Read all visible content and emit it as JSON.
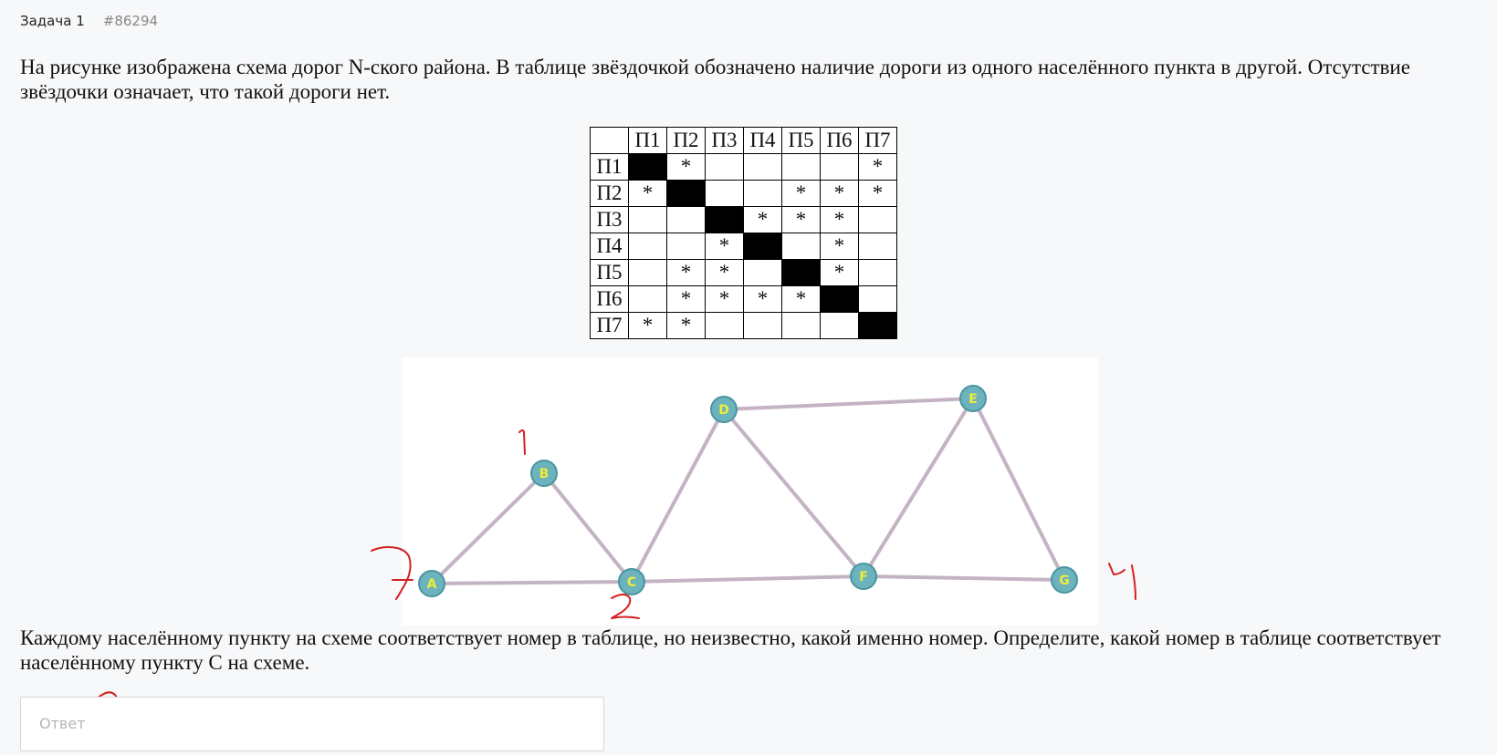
{
  "header": {
    "title": "Задача 1",
    "id": "#86294"
  },
  "question": "На рисунке изображена схема дорог N-ского района. В таблице звёздочкой обозначено наличие дороги из одного населённого пункта в другой. Отсутствие звёздочки означает, что такой дороги нет.",
  "table": {
    "headers": [
      "П1",
      "П2",
      "П3",
      "П4",
      "П5",
      "П6",
      "П7"
    ],
    "rows": [
      {
        "label": "П1",
        "cells": [
          "#",
          "*",
          "",
          "",
          "",
          "",
          "*"
        ]
      },
      {
        "label": "П2",
        "cells": [
          "*",
          "#",
          "",
          "",
          "*",
          "*",
          "*"
        ]
      },
      {
        "label": "П3",
        "cells": [
          "",
          "",
          "#",
          "*",
          "*",
          "*",
          ""
        ]
      },
      {
        "label": "П4",
        "cells": [
          "",
          "",
          "*",
          "#",
          "",
          "*",
          ""
        ]
      },
      {
        "label": "П5",
        "cells": [
          "",
          "*",
          "*",
          "",
          "#",
          "*",
          ""
        ]
      },
      {
        "label": "П6",
        "cells": [
          "",
          "*",
          "*",
          "*",
          "*",
          "#",
          ""
        ]
      },
      {
        "label": "П7",
        "cells": [
          "*",
          "*",
          "",
          "",
          "",
          "",
          "#"
        ]
      }
    ]
  },
  "graph": {
    "edge_color": "#c3b3c3",
    "node_fill": "#6cb3bd",
    "node_stroke": "#4a95a0",
    "label_color": "#f0ec3a",
    "nodes": [
      {
        "id": "A"
      },
      {
        "id": "B"
      },
      {
        "id": "C"
      },
      {
        "id": "D"
      },
      {
        "id": "E"
      },
      {
        "id": "F"
      },
      {
        "id": "G"
      }
    ],
    "edges": [
      [
        "A",
        "B"
      ],
      [
        "A",
        "C"
      ],
      [
        "B",
        "C"
      ],
      [
        "C",
        "D"
      ],
      [
        "C",
        "F"
      ],
      [
        "D",
        "E"
      ],
      [
        "D",
        "F"
      ],
      [
        "E",
        "F"
      ],
      [
        "E",
        "G"
      ],
      [
        "F",
        "G"
      ]
    ]
  },
  "annotations": {
    "color": "#d42020",
    "handwritten": [
      "1",
      "7",
      "2",
      "4",
      "2"
    ]
  },
  "question2": "Каждому населённому пункту на схеме соответствует номер в таблице, но неизвестно, какой именно номер. Определите, какой номер в таблице соответствует населённому пункту C на схеме.",
  "answer": {
    "placeholder": "Ответ",
    "value": ""
  }
}
